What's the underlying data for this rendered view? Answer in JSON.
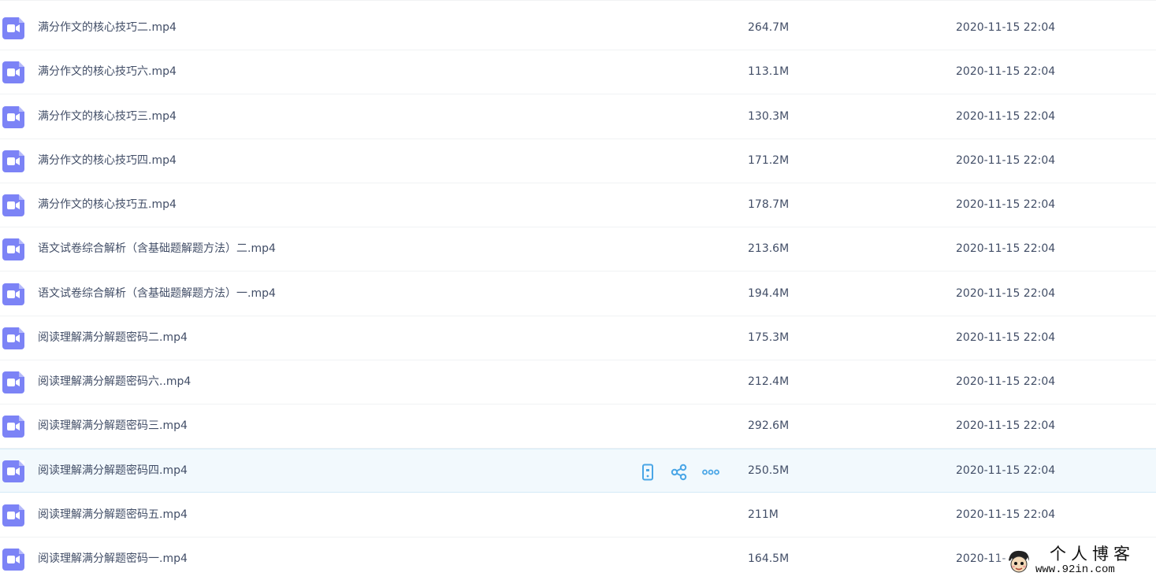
{
  "files": [
    {
      "name": "满分作文的核心技巧二.mp4",
      "size": "264.7M",
      "modified": "2020-11-15 22:04",
      "type_icon": "video-file-icon"
    },
    {
      "name": "满分作文的核心技巧六.mp4",
      "size": "113.1M",
      "modified": "2020-11-15 22:04",
      "type_icon": "video-file-icon"
    },
    {
      "name": "满分作文的核心技巧三.mp4",
      "size": "130.3M",
      "modified": "2020-11-15 22:04",
      "type_icon": "video-file-icon"
    },
    {
      "name": "满分作文的核心技巧四.mp4",
      "size": "171.2M",
      "modified": "2020-11-15 22:04",
      "type_icon": "video-file-icon"
    },
    {
      "name": "满分作文的核心技巧五.mp4",
      "size": "178.7M",
      "modified": "2020-11-15 22:04",
      "type_icon": "video-file-icon"
    },
    {
      "name": "语文试卷综合解析（含基础题解题方法）二.mp4",
      "size": "213.6M",
      "modified": "2020-11-15 22:04",
      "type_icon": "video-file-icon"
    },
    {
      "name": "语文试卷综合解析（含基础题解题方法）一.mp4",
      "size": "194.4M",
      "modified": "2020-11-15 22:04",
      "type_icon": "video-file-icon"
    },
    {
      "name": "阅读理解满分解题密码二.mp4",
      "size": "175.3M",
      "modified": "2020-11-15 22:04",
      "type_icon": "video-file-icon"
    },
    {
      "name": "阅读理解满分解题密码六..mp4",
      "size": "212.4M",
      "modified": "2020-11-15 22:04",
      "type_icon": "video-file-icon"
    },
    {
      "name": "阅读理解满分解题密码三.mp4",
      "size": "292.6M",
      "modified": "2020-11-15 22:04",
      "type_icon": "video-file-icon"
    },
    {
      "name": "阅读理解满分解题密码四.mp4",
      "size": "250.5M",
      "modified": "2020-11-15 22:04",
      "type_icon": "video-file-icon",
      "hovered": true
    },
    {
      "name": "阅读理解满分解题密码五.mp4",
      "size": "211M",
      "modified": "2020-11-15 22:04",
      "type_icon": "video-file-icon"
    },
    {
      "name": "阅读理解满分解题密码一.mp4",
      "size": "164.5M",
      "modified": "2020-11-",
      "type_icon": "video-file-icon"
    }
  ],
  "row_actions": {
    "icons": [
      "phone-icon",
      "share-icon",
      "more-icon"
    ],
    "color": "#4aa6e6"
  },
  "colors": {
    "file_icon": "#7c83f6",
    "hover_row_bg": "#f2f9fd",
    "row_divider": "#f1f2f4",
    "text": "#424e67"
  },
  "watermark": {
    "title": "个人博客",
    "url": "www.92in.com",
    "avatar_icon": "cartoon-avatar-icon"
  }
}
